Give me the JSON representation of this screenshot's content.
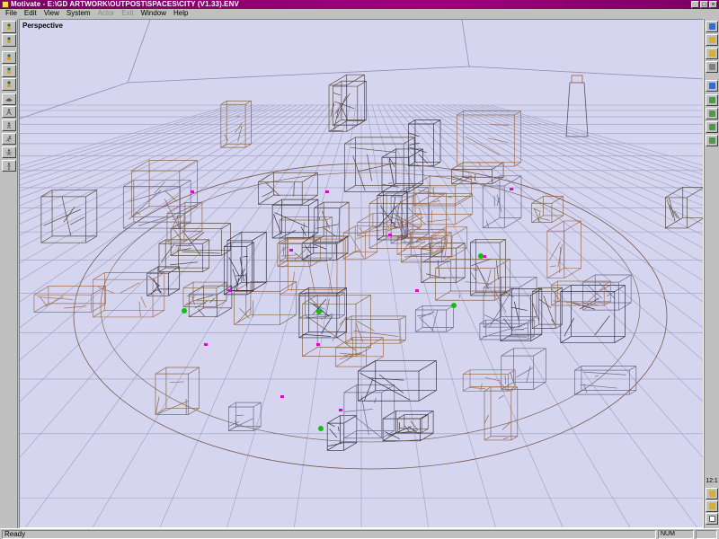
{
  "window": {
    "title": "Motivate - E:\\GD ARTWORK\\OUTPOST\\SPACES\\CITY (V1.33).ENV",
    "controls": [
      "minimize",
      "maximize",
      "close"
    ]
  },
  "menubar": {
    "items": [
      {
        "label": "File",
        "enabled": true
      },
      {
        "label": "Edit",
        "enabled": true
      },
      {
        "label": "View",
        "enabled": true
      },
      {
        "label": "System",
        "enabled": true
      },
      {
        "label": "Actor",
        "enabled": false
      },
      {
        "label": "Exit",
        "enabled": false
      },
      {
        "label": "Window",
        "enabled": true
      },
      {
        "label": "Help",
        "enabled": true
      }
    ]
  },
  "left_toolbar": {
    "tools": [
      {
        "name": "edit-actors-tool",
        "icon": "figure-icon"
      },
      {
        "name": "actors-tool",
        "icon": "figure-icon"
      },
      {
        "name": "actors-alt-tool",
        "icon": "figure-icon"
      },
      {
        "name": "actions-tool",
        "icon": "figure-icon"
      },
      {
        "name": "select-tool",
        "icon": "figure-icon"
      },
      {
        "name": "weapon-tool",
        "icon": "ship-icon"
      },
      {
        "name": "run-tool",
        "icon": "running-figure-icon"
      },
      {
        "name": "walk-tool",
        "icon": "walking-figure-icon"
      },
      {
        "name": "jump-tool",
        "icon": "jumping-figure-icon"
      },
      {
        "name": "fall-tool",
        "icon": "falling-figure-icon"
      },
      {
        "name": "stand-tool",
        "icon": "standing-figure-icon"
      }
    ]
  },
  "right_toolbar": {
    "top_tools": [
      {
        "name": "orbit-tool",
        "icon": "orbit-icon",
        "color": "#2a6fd6"
      },
      {
        "name": "pan-tool",
        "icon": "pan-icon",
        "color": "#d6b02a"
      },
      {
        "name": "zoom-tool",
        "icon": "zoom-icon",
        "color": "#d6b02a"
      },
      {
        "name": "fit-tool",
        "icon": "fit-icon",
        "color": "#808080"
      },
      {
        "name": "light-tool",
        "icon": "lightbulb-icon",
        "color": "#2a6fd6"
      },
      {
        "name": "camera-tool",
        "icon": "camera-icon",
        "color": "#4a9a4a"
      },
      {
        "name": "path-tool",
        "icon": "path-icon",
        "color": "#4a9a4a"
      },
      {
        "name": "node-tool",
        "icon": "node-icon",
        "color": "#4a9a4a"
      },
      {
        "name": "marker-tool",
        "icon": "marker-icon",
        "color": "#4a9a4a"
      }
    ],
    "zoom_readout": "12:1",
    "bottom_tools": [
      {
        "name": "play-tool",
        "icon": "play-icon",
        "color": "#d6b02a"
      },
      {
        "name": "step-tool",
        "icon": "step-icon",
        "color": "#d6b02a"
      },
      {
        "name": "cursor-tool",
        "icon": "cursor-icon",
        "color": "#ffffff"
      },
      {
        "name": "pointer-tool",
        "icon": "hand-icon",
        "color": "#ffffff"
      },
      {
        "name": "record-tool",
        "icon": "record-icon",
        "color": "#b01010"
      }
    ]
  },
  "viewport": {
    "label": "Perspective",
    "background": "#d5d5f0",
    "grid_color": "#8c8cb0",
    "wire_colors": [
      "#5a4a3a",
      "#8a6a4a",
      "#333344",
      "#a07050",
      "#6a6a8a"
    ],
    "marker_colors": {
      "magenta": "#e000e0",
      "green": "#10c010"
    }
  },
  "statusbar": {
    "status_text": "Ready",
    "indicator": "NUM"
  }
}
